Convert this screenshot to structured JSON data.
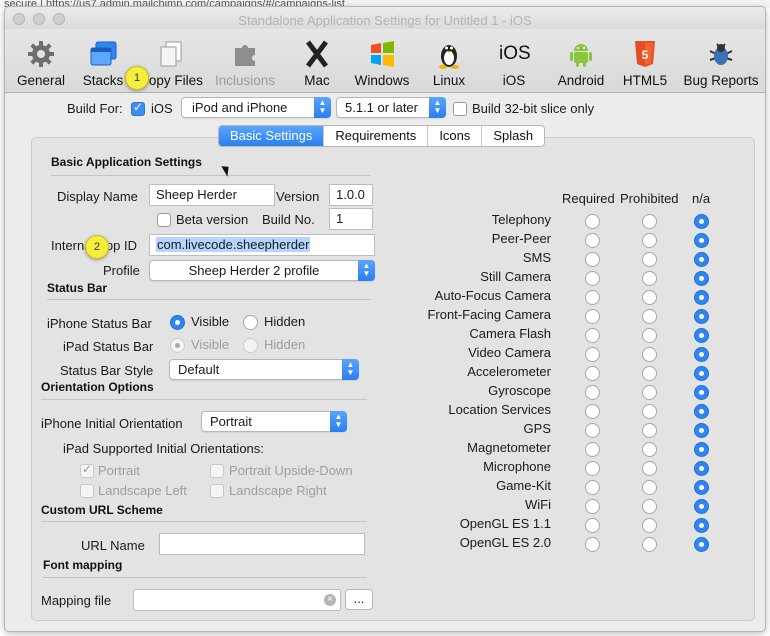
{
  "background": {
    "url_text": "secure | https://us7.admin.mailchimp.com/campaigns/#/campaigns-list"
  },
  "window": {
    "title": "Standalone Application Settings for Untitled 1 - iOS"
  },
  "toolbar": {
    "items": [
      {
        "label": "General",
        "icon": "gear-icon",
        "enabled": true
      },
      {
        "label": "Stacks",
        "icon": "stacks-icon",
        "enabled": true
      },
      {
        "label": "Copy Files",
        "icon": "files-icon",
        "enabled": true
      },
      {
        "label": "Inclusions",
        "icon": "puzzle-icon",
        "enabled": false
      },
      {
        "label": "Mac",
        "icon": "mac-x-icon",
        "enabled": true
      },
      {
        "label": "Windows",
        "icon": "windows-icon",
        "enabled": true
      },
      {
        "label": "Linux",
        "icon": "linux-penguin-icon",
        "enabled": true
      },
      {
        "label": "iOS",
        "icon": "ios-icon",
        "enabled": true
      },
      {
        "label": "Android",
        "icon": "android-icon",
        "enabled": true
      },
      {
        "label": "HTML5",
        "icon": "html5-icon",
        "enabled": true
      },
      {
        "label": "Bug Reports",
        "icon": "bug-icon",
        "enabled": true
      }
    ]
  },
  "build": {
    "label": "Build For:",
    "ios_label": "iOS",
    "ios_checked": true,
    "device": "iPod and iPhone",
    "version": "5.1.1 or later",
    "slice_label": "Build 32-bit slice only",
    "slice_checked": false
  },
  "tabs": [
    {
      "label": "Basic Settings",
      "active": true
    },
    {
      "label": "Requirements",
      "active": false
    },
    {
      "label": "Icons",
      "active": false
    },
    {
      "label": "Splash",
      "active": false
    }
  ],
  "basic": {
    "section_title": "Basic Application Settings",
    "display_name_label": "Display Name",
    "display_name_value": "Sheep Herder",
    "version_label": "Version",
    "version_value": "1.0.0",
    "beta_label": "Beta version",
    "build_no_label": "Build No.",
    "build_no_value": "1",
    "app_id_label": "Internal App ID",
    "app_id_value": "com.livecode.sheepherder",
    "profile_label": "Profile",
    "profile_value": "Sheep Herder 2 profile"
  },
  "status_bar": {
    "section_title": "Status Bar",
    "iphone_label": "iPhone Status Bar",
    "ipad_label": "iPad Status Bar",
    "visible_label": "Visible",
    "hidden_label": "Hidden",
    "style_label": "Status Bar Style",
    "style_value": "Default"
  },
  "orientation": {
    "section_title": "Orientation Options",
    "iphone_label": "iPhone Initial Orientation",
    "iphone_value": "Portrait",
    "ipad_label": "iPad Supported Initial Orientations:",
    "portrait": "Portrait",
    "portrait_upside": "Portrait Upside-Down",
    "landscape_left": "Landscape Left",
    "landscape_right": "Landscape Right"
  },
  "url_scheme": {
    "section_title": "Custom URL Scheme",
    "label": "URL Name",
    "value": ""
  },
  "font_mapping": {
    "section_title": "Font mapping",
    "label": "Mapping file",
    "value": "",
    "browse_label": "..."
  },
  "requirements": {
    "headers": [
      "Required",
      "Prohibited",
      "n/a"
    ],
    "items": [
      {
        "label": "Telephony",
        "selected": "n/a"
      },
      {
        "label": "Peer-Peer",
        "selected": "n/a"
      },
      {
        "label": "SMS",
        "selected": "n/a"
      },
      {
        "label": "Still Camera",
        "selected": "n/a"
      },
      {
        "label": "Auto-Focus Camera",
        "selected": "n/a"
      },
      {
        "label": "Front-Facing Camera",
        "selected": "n/a"
      },
      {
        "label": "Camera Flash",
        "selected": "n/a"
      },
      {
        "label": "Video Camera",
        "selected": "n/a"
      },
      {
        "label": "Accelerometer",
        "selected": "n/a"
      },
      {
        "label": "Gyroscope",
        "selected": "n/a"
      },
      {
        "label": "Location Services",
        "selected": "n/a"
      },
      {
        "label": "GPS",
        "selected": "n/a"
      },
      {
        "label": "Magnetometer",
        "selected": "n/a"
      },
      {
        "label": "Microphone",
        "selected": "n/a"
      },
      {
        "label": "Game-Kit",
        "selected": "n/a"
      },
      {
        "label": "WiFi",
        "selected": "n/a"
      },
      {
        "label": "OpenGL ES 1.1",
        "selected": "n/a"
      },
      {
        "label": "OpenGL ES 2.0",
        "selected": "n/a"
      }
    ]
  },
  "callouts": {
    "one": "1",
    "two": "2"
  },
  "colors": {
    "accent": "#2f86f2",
    "callout": "#f5ee3a"
  }
}
